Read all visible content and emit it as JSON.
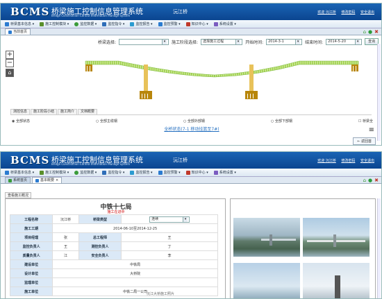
{
  "app": {
    "logo": "BCMS",
    "title": "桥梁施工控制信息管理系统",
    "subtitle": "Bridge Construction Control Information Manage System",
    "project": "沅江桥",
    "user_links": [
      "欢迎 沅江桥",
      "修改密码",
      "安全退出"
    ]
  },
  "menu": [
    {
      "label": "桥梁基本信息 ▾",
      "color": "#2b7bd0"
    },
    {
      "label": "施工控制模块 ▾",
      "color": "#5a8f2b"
    },
    {
      "label": "监控数据 ▾",
      "color": "#3a9b3a"
    },
    {
      "label": "监控指令 ▾",
      "color": "#2e6db8"
    },
    {
      "label": "监控报告 ▾",
      "color": "#2b9bd0"
    },
    {
      "label": "监控预警 ▾",
      "color": "#2b7bd0"
    },
    {
      "label": "知识中心 ▾",
      "color": "#c0392b"
    },
    {
      "label": "系统设置 ▾",
      "color": "#7b5cc0"
    }
  ],
  "win1": {
    "tabs": [
      "当前首页"
    ],
    "filter": {
      "part_label": "桥梁选择:",
      "part_value": "",
      "stage_label": "施工阶段选择:",
      "stage_value": "选择施工过程",
      "start_label": "开始时间:",
      "start_value": "2014-3-1",
      "end_label": "结束时间:",
      "end_value": "2014-5-20",
      "query": "查询"
    },
    "bottom_tabs": [
      "测控信息",
      "施工阶段小结",
      "施工简介",
      "文档概要"
    ],
    "radios": [
      "全部状态",
      "全部主缆钢",
      "全部外部钢",
      "全部下部钢",
      "桥梁全"
    ],
    "status_link": "全桥状态(7-1 移动挂篮至7#)",
    "return_button": "← 返回首"
  },
  "win2": {
    "tabs": [
      "系统首页",
      "基本概要"
    ],
    "back": "查看施工概况",
    "project_name": "中铁十七局",
    "project_state": "施工在进中",
    "rows": [
      [
        "工程名称",
        "沅江桥",
        "桥梁类型",
        "连续"
      ],
      [
        "施工工期",
        "2014-06-10至2014-12-25",
        "",
        ""
      ],
      [
        "项目经理",
        "张",
        "总工程师",
        "王"
      ],
      [
        "监控负责人",
        "王",
        "测控负责人",
        "丁"
      ],
      [
        "质量负责人",
        "江",
        "安全负责人",
        "李"
      ],
      [
        "建设单位",
        "",
        "中铁局",
        ""
      ],
      [
        "设计单位",
        "",
        "大桥院",
        ""
      ],
      [
        "监理单位",
        "",
        "",
        ""
      ],
      [
        "施工单位",
        "",
        "中铁二局一公司",
        ""
      ]
    ],
    "caption": "沅江大桥施工照片"
  }
}
